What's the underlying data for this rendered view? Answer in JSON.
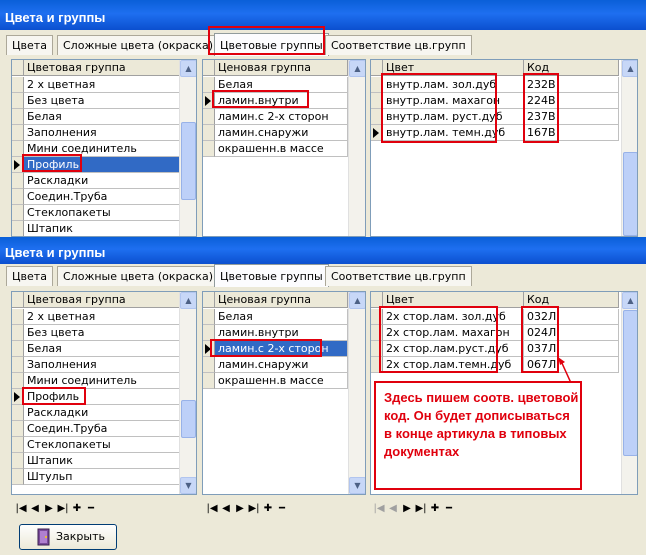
{
  "window_title": "Цвета и группы",
  "tabs": [
    "Цвета",
    "Сложные цвета (окраска)",
    "Цветовые группы",
    "Соответствие цв.групп"
  ],
  "top": {
    "groups_header": "Цветовая группа",
    "groups": [
      "2 х цветная",
      "Без цвета",
      "Белая",
      "Заполнения",
      "Мини соединитель",
      "Профиль",
      "Раскладки",
      "Соедин.Труба",
      "Стеклопакеты",
      "Штапик"
    ],
    "price_header": "Ценовая группа",
    "price_groups": [
      "Белая",
      "ламин.внутри",
      "ламин.с 2-х сторон",
      "ламин.снаружи",
      "окрашенн.в массе"
    ],
    "color_header": "Цвет",
    "code_header": "Код",
    "colors": [
      {
        "name": "внутр.лам. зол.дуб",
        "code": "232В"
      },
      {
        "name": "внутр.лам. махагон",
        "code": "224В"
      },
      {
        "name": "внутр.лам. руст.дуб",
        "code": "237В"
      },
      {
        "name": "внутр.лам. темн.дуб",
        "code": "167В"
      }
    ]
  },
  "bottom": {
    "groups_header": "Цветовая группа",
    "groups": [
      "2 х цветная",
      "Без цвета",
      "Белая",
      "Заполнения",
      "Мини соединитель",
      "Профиль",
      "Раскладки",
      "Соедин.Труба",
      "Стеклопакеты",
      "Штапик",
      "Штульп"
    ],
    "price_header": "Ценовая группа",
    "price_groups": [
      "Белая",
      "ламин.внутри",
      "ламин.с 2-х сторон",
      "ламин.снаружи",
      "окрашенн.в массе"
    ],
    "color_header": "Цвет",
    "code_header": "Код",
    "colors": [
      {
        "name": "2х стор.лам. зол.дуб",
        "code": "032Л"
      },
      {
        "name": "2х стор.лам. махагон",
        "code": "024Л"
      },
      {
        "name": "2х стор.лам.руст.дуб",
        "code": "037Л"
      },
      {
        "name": "2х стор.лам.темн.дуб",
        "code": "067Л"
      }
    ]
  },
  "note": "Здесь пишем соотв. цветовой код. Он будет дописываться в конце артикула в типовых документах",
  "close_label": "Закрыть",
  "icons": {
    "first": "first-record-icon",
    "prev": "prev-record-icon",
    "next": "next-record-icon",
    "last": "last-record-icon",
    "add": "add-record-icon",
    "delete": "delete-record-icon"
  },
  "colors": {
    "title_bar": "#0a5fd8",
    "selection": "#316ac5",
    "highlight_box": "#e0000d"
  }
}
